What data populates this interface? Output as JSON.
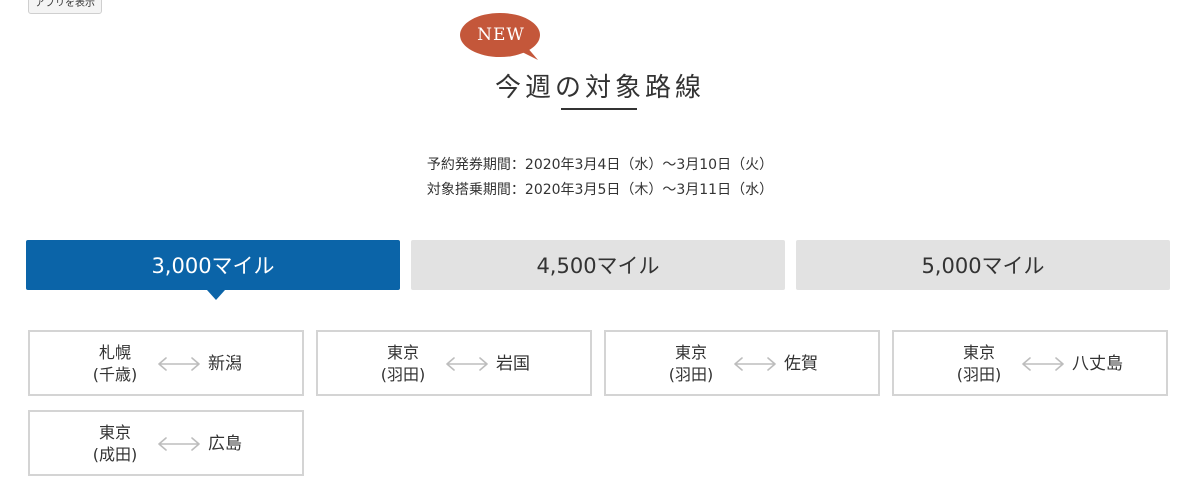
{
  "tooltip": {
    "text": "アプリを表示"
  },
  "header": {
    "badge": "NEW",
    "title": "今週の対象路線"
  },
  "periods": {
    "booking": "予約発券期間：2020年3月4日（水）〜3月10日（火）",
    "boarding": "対象搭乗期間：2020年3月5日（木）〜3月11日（水）"
  },
  "tabs": [
    {
      "label": "3,000マイル",
      "active": true
    },
    {
      "label": "4,500マイル",
      "active": false
    },
    {
      "label": "5,000マイル",
      "active": false
    }
  ],
  "routes": [
    {
      "origin_city": "札幌",
      "origin_airport": "(千歳)",
      "destination": "新潟"
    },
    {
      "origin_city": "東京",
      "origin_airport": "(羽田)",
      "destination": "岩国"
    },
    {
      "origin_city": "東京",
      "origin_airport": "(羽田)",
      "destination": "佐賀"
    },
    {
      "origin_city": "東京",
      "origin_airport": "(羽田)",
      "destination": "八丈島"
    },
    {
      "origin_city": "東京",
      "origin_airport": "(成田)",
      "destination": "広島"
    }
  ],
  "colors": {
    "badge": "#c4573a",
    "tab_active": "#0b64a8",
    "tab_inactive": "#e2e2e2",
    "card_border": "#d4d4d4",
    "arrow": "#bdbdbd"
  },
  "icons": {
    "route_arrow": "double-arrow-icon",
    "badge_shape": "speech-bubble-icon"
  }
}
